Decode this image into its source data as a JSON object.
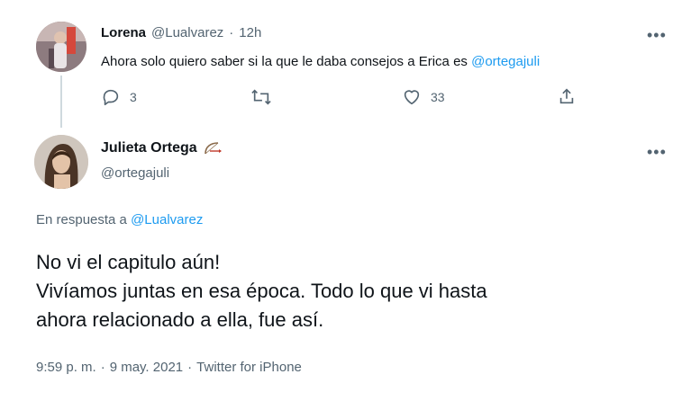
{
  "reply_to_tweet": {
    "author_name": "Lorena",
    "author_handle": "@Lualvarez",
    "separator": "·",
    "time": "12h",
    "text_prefix": "Ahora solo quiero saber si la que le daba consejos a Erica es",
    "text_mention": "@ortegajuli",
    "reply_count": "3",
    "like_count": "33",
    "more_icon": "more-dots-icon"
  },
  "main_tweet": {
    "author_name": "Julieta Ortega",
    "author_handle": "@ortegajuli",
    "emoji_icon": "bow-arrow-emoji-icon",
    "replying_label": "En respuesta a",
    "replying_mention": "@Lualvarez",
    "text_line1": "No vi el capitulo aún!",
    "text_line2": "Vivíamos juntas en esa época. Todo lo que vi hasta",
    "text_line3": "ahora relacionado a ella, fue así.",
    "meta_time": "9:59 p. m.",
    "meta_separator1": "·",
    "meta_date": "9 may. 2021",
    "meta_separator2": "·",
    "meta_source": "Twitter for iPhone"
  },
  "colors": {
    "accent": "#1d9bf0",
    "muted": "#536471",
    "thread_line": "#cfd9de"
  }
}
